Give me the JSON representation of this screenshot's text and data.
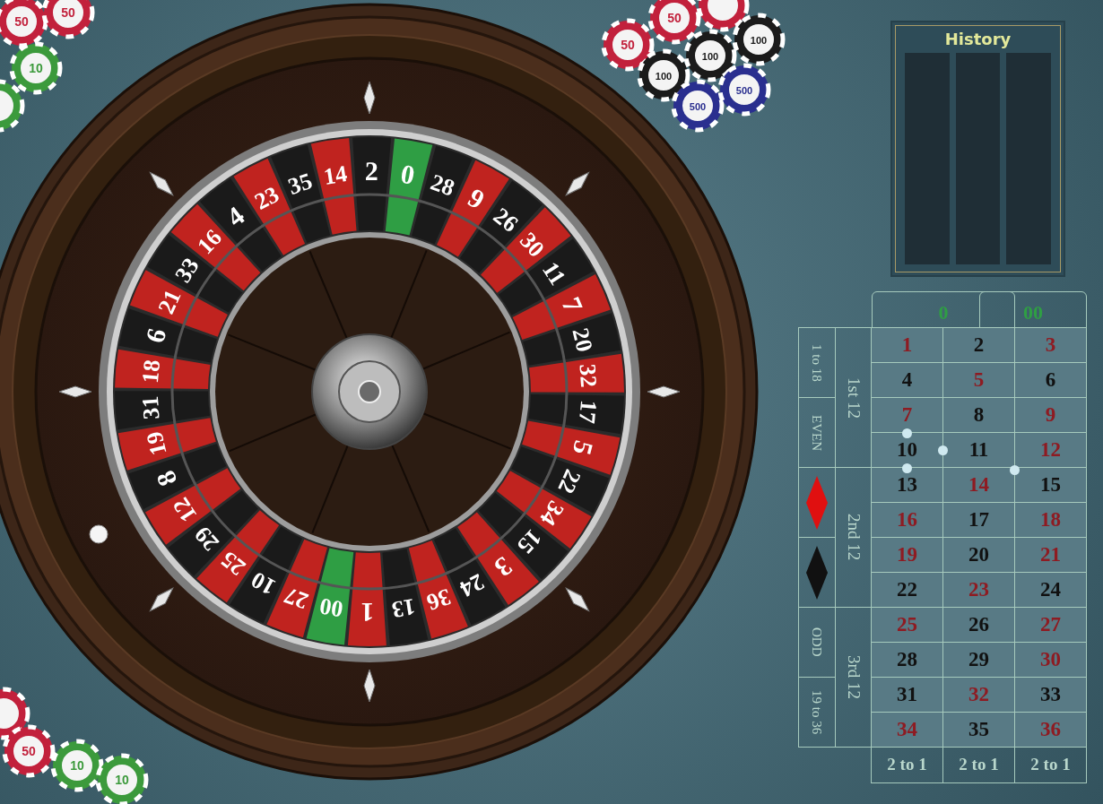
{
  "wheel": {
    "pockets": [
      {
        "number": "0",
        "color": "#2f9e44"
      },
      {
        "number": "28",
        "color": "#1a1a1a"
      },
      {
        "number": "9",
        "color": "#c0231f"
      },
      {
        "number": "26",
        "color": "#1a1a1a"
      },
      {
        "number": "30",
        "color": "#c0231f"
      },
      {
        "number": "11",
        "color": "#1a1a1a"
      },
      {
        "number": "7",
        "color": "#c0231f"
      },
      {
        "number": "20",
        "color": "#1a1a1a"
      },
      {
        "number": "32",
        "color": "#c0231f"
      },
      {
        "number": "17",
        "color": "#1a1a1a"
      },
      {
        "number": "5",
        "color": "#c0231f"
      },
      {
        "number": "22",
        "color": "#1a1a1a"
      },
      {
        "number": "34",
        "color": "#c0231f"
      },
      {
        "number": "15",
        "color": "#1a1a1a"
      },
      {
        "number": "3",
        "color": "#c0231f"
      },
      {
        "number": "24",
        "color": "#1a1a1a"
      },
      {
        "number": "36",
        "color": "#c0231f"
      },
      {
        "number": "13",
        "color": "#1a1a1a"
      },
      {
        "number": "1",
        "color": "#c0231f"
      },
      {
        "number": "00",
        "color": "#2f9e44"
      },
      {
        "number": "27",
        "color": "#c0231f"
      },
      {
        "number": "10",
        "color": "#1a1a1a"
      },
      {
        "number": "25",
        "color": "#c0231f"
      },
      {
        "number": "29",
        "color": "#1a1a1a"
      },
      {
        "number": "12",
        "color": "#c0231f"
      },
      {
        "number": "8",
        "color": "#1a1a1a"
      },
      {
        "number": "19",
        "color": "#c0231f"
      },
      {
        "number": "31",
        "color": "#1a1a1a"
      },
      {
        "number": "18",
        "color": "#c0231f"
      },
      {
        "number": "6",
        "color": "#1a1a1a"
      },
      {
        "number": "21",
        "color": "#c0231f"
      },
      {
        "number": "33",
        "color": "#1a1a1a"
      },
      {
        "number": "16",
        "color": "#c0231f"
      },
      {
        "number": "4",
        "color": "#1a1a1a"
      },
      {
        "number": "23",
        "color": "#c0231f"
      },
      {
        "number": "35",
        "color": "#1a1a1a"
      },
      {
        "number": "14",
        "color": "#c0231f"
      },
      {
        "number": "2",
        "color": "#1a1a1a"
      }
    ]
  },
  "chips": [
    {
      "label": "50",
      "color": "#c2213c"
    },
    {
      "label": "50",
      "color": "#c2213c"
    },
    {
      "label": "10",
      "color": "#3c9a3c"
    },
    {
      "color": "#3c9a3c"
    },
    {
      "label": "50",
      "color": "#c2213c"
    },
    {
      "label": "50",
      "color": "#c2213c"
    },
    {
      "color": "#c2213c"
    },
    {
      "label": "100",
      "color": "#1b1b1b"
    },
    {
      "label": "100",
      "color": "#1b1b1b"
    },
    {
      "label": "100",
      "color": "#1b1b1b"
    },
    {
      "label": "500",
      "color": "#2a2f8f"
    },
    {
      "label": "500",
      "color": "#2a2f8f"
    },
    {
      "color": "#c2213c"
    },
    {
      "label": "50",
      "color": "#c2213c"
    },
    {
      "label": "10",
      "color": "#3c9a3c"
    },
    {
      "label": "10",
      "color": "#3c9a3c"
    }
  ],
  "history": {
    "title": "History"
  },
  "board": {
    "zeros": [
      {
        "label": "0",
        "color": "#2f9e44"
      },
      {
        "label": "00",
        "color": "#2f9e44"
      }
    ],
    "outside": [
      {
        "kind": "text",
        "label": "1 to 18"
      },
      {
        "kind": "text",
        "label": "EVEN"
      },
      {
        "kind": "diamond",
        "color": "#e01010"
      },
      {
        "kind": "diamond",
        "color": "#111111"
      },
      {
        "kind": "text",
        "label": "ODD"
      },
      {
        "kind": "text",
        "label": "19 to 36"
      }
    ],
    "dozens": [
      "1st 12",
      "2nd 12",
      "3rd 12"
    ],
    "numbers": [
      {
        "label": "1",
        "color": "#8e1b22"
      },
      {
        "label": "2",
        "color": "#111111"
      },
      {
        "label": "3",
        "color": "#8e1b22"
      },
      {
        "label": "4",
        "color": "#111111"
      },
      {
        "label": "5",
        "color": "#8e1b22"
      },
      {
        "label": "6",
        "color": "#111111"
      },
      {
        "label": "7",
        "color": "#8e1b22"
      },
      {
        "label": "8",
        "color": "#111111"
      },
      {
        "label": "9",
        "color": "#8e1b22"
      },
      {
        "label": "10",
        "color": "#111111"
      },
      {
        "label": "11",
        "color": "#111111"
      },
      {
        "label": "12",
        "color": "#8e1b22"
      },
      {
        "label": "13",
        "color": "#111111"
      },
      {
        "label": "14",
        "color": "#8e1b22"
      },
      {
        "label": "15",
        "color": "#111111"
      },
      {
        "label": "16",
        "color": "#8e1b22"
      },
      {
        "label": "17",
        "color": "#111111"
      },
      {
        "label": "18",
        "color": "#8e1b22"
      },
      {
        "label": "19",
        "color": "#8e1b22"
      },
      {
        "label": "20",
        "color": "#111111"
      },
      {
        "label": "21",
        "color": "#8e1b22"
      },
      {
        "label": "22",
        "color": "#111111"
      },
      {
        "label": "23",
        "color": "#8e1b22"
      },
      {
        "label": "24",
        "color": "#111111"
      },
      {
        "label": "25",
        "color": "#8e1b22"
      },
      {
        "label": "26",
        "color": "#111111"
      },
      {
        "label": "27",
        "color": "#8e1b22"
      },
      {
        "label": "28",
        "color": "#111111"
      },
      {
        "label": "29",
        "color": "#111111"
      },
      {
        "label": "30",
        "color": "#8e1b22"
      },
      {
        "label": "31",
        "color": "#111111"
      },
      {
        "label": "32",
        "color": "#8e1b22"
      },
      {
        "label": "33",
        "color": "#111111"
      },
      {
        "label": "34",
        "color": "#8e1b22"
      },
      {
        "label": "35",
        "color": "#111111"
      },
      {
        "label": "36",
        "color": "#8e1b22"
      }
    ],
    "columns": [
      "2 to 1",
      "2 to 1",
      "2 to 1"
    ]
  }
}
